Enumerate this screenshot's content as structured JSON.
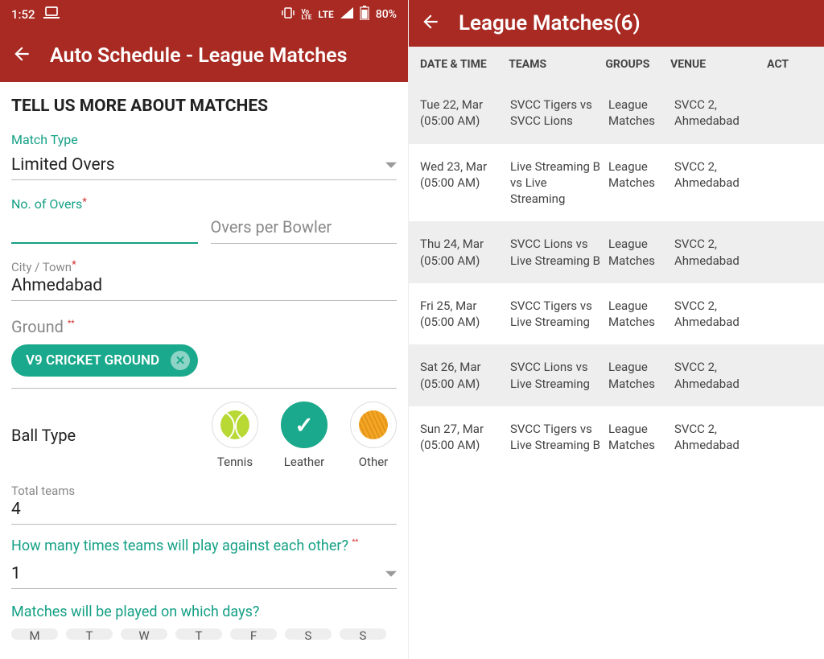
{
  "status": {
    "time": "1:52",
    "volte": "VoLTE",
    "lte": "LTE",
    "battery": "80%"
  },
  "left": {
    "title": "Auto Schedule - League Matches",
    "section_heading": "TELL US MORE ABOUT MATCHES",
    "match_type_label": "Match Type",
    "match_type_value": "Limited Overs",
    "overs_label": "No. of Overs",
    "overs_per_bowler_placeholder": "Overs per Bowler",
    "city_label": "City / Town",
    "city_value": "Ahmedabad",
    "ground_label": "Ground",
    "ground_chip": "V9 CRICKET GROUND",
    "ball_type_label": "Ball Type",
    "ball_options": {
      "tennis": "Tennis",
      "leather": "Leather",
      "other": "Other"
    },
    "total_teams_label": "Total teams",
    "total_teams_value": "4",
    "play_times_question": "How many times teams will play against each other?",
    "play_times_value": "1",
    "days_question": "Matches will be played on which days?",
    "days": [
      "M",
      "T",
      "W",
      "T",
      "F",
      "S",
      "S"
    ]
  },
  "right": {
    "title": "League Matches(6)",
    "headers": {
      "datetime": "DATE & TIME",
      "teams": "TEAMS",
      "groups": "GROUPS",
      "venue": "VENUE",
      "act": "ACT"
    },
    "rows": [
      {
        "datetime": "Tue 22, Mar (05:00 AM)",
        "teams": "SVCC Tigers vs SVCC Lions",
        "groups": "League Matches",
        "venue": "SVCC 2, Ahmedabad"
      },
      {
        "datetime": "Wed 23, Mar (05:00 AM)",
        "teams": "Live Streaming B vs Live Streaming",
        "groups": "League Matches",
        "venue": "SVCC 2, Ahmedabad"
      },
      {
        "datetime": "Thu 24, Mar (05:00 AM)",
        "teams": "SVCC Lions vs Live Streaming B",
        "groups": "League Matches",
        "venue": "SVCC 2, Ahmedabad"
      },
      {
        "datetime": "Fri 25, Mar (05:00 AM)",
        "teams": "SVCC Tigers vs Live Streaming",
        "groups": "League Matches",
        "venue": "SVCC 2, Ahmedabad"
      },
      {
        "datetime": "Sat 26, Mar (05:00 AM)",
        "teams": "SVCC Lions vs Live Streaming",
        "groups": "League Matches",
        "venue": "SVCC 2, Ahmedabad"
      },
      {
        "datetime": "Sun 27, Mar (05:00 AM)",
        "teams": "SVCC Tigers vs Live Streaming B",
        "groups": "League Matches",
        "venue": "SVCC 2, Ahmedabad"
      }
    ]
  }
}
